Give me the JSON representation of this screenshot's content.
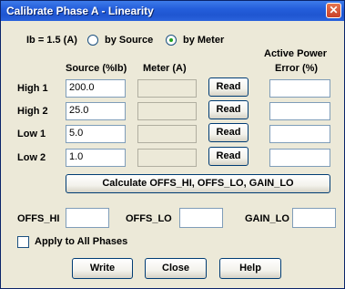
{
  "window": {
    "title": "Calibrate Phase A - Linearity",
    "close_glyph": "✕"
  },
  "mode": {
    "ib_label": "Ib = 1.5 (A)",
    "options": [
      {
        "label": "by Source",
        "checked": false
      },
      {
        "label": "by Meter",
        "checked": true
      }
    ]
  },
  "headers": {
    "source": "Source (%Ib)",
    "meter": "Meter (A)",
    "error_line1": "Active Power",
    "error_line2": "Error (%)"
  },
  "rows": [
    {
      "label": "High 1",
      "source": "200.0",
      "meter": "",
      "read_label": "Read",
      "error": ""
    },
    {
      "label": "High 2",
      "source": "25.0",
      "meter": "",
      "read_label": "Read",
      "error": ""
    },
    {
      "label": "Low 1",
      "source": "5.0",
      "meter": "",
      "read_label": "Read",
      "error": ""
    },
    {
      "label": "Low 2",
      "source": "1.0",
      "meter": "",
      "read_label": "Read",
      "error": ""
    }
  ],
  "calculate_label": "Calculate OFFS_HI, OFFS_LO, GAIN_LO",
  "results": {
    "offs_hi_label": "OFFS_HI",
    "offs_hi": "",
    "offs_lo_label": "OFFS_LO",
    "offs_lo": "",
    "gain_lo_label": "GAIN_LO",
    "gain_lo": ""
  },
  "apply_all": {
    "label": "Apply to All Phases",
    "checked": false
  },
  "buttons": {
    "write": "Write",
    "close": "Close",
    "help": "Help"
  }
}
